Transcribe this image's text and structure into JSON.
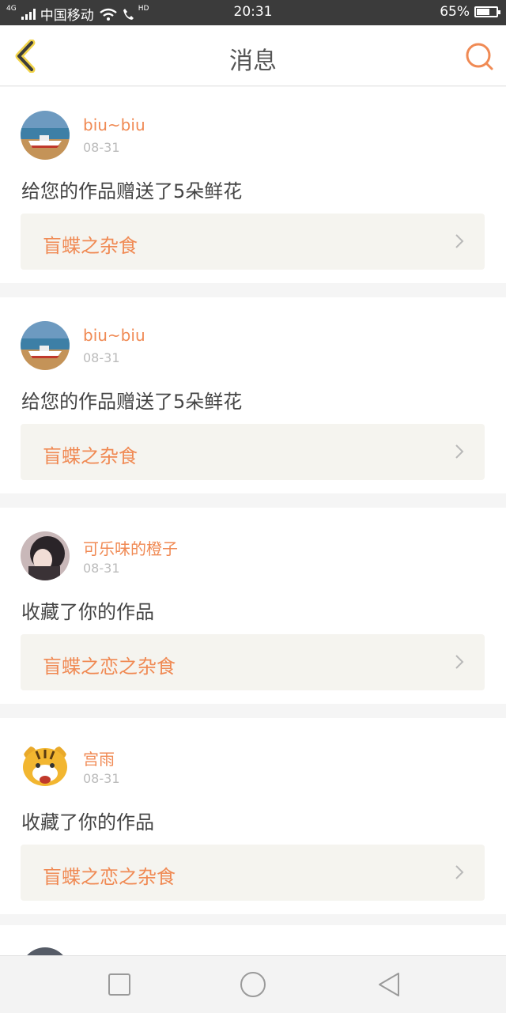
{
  "status_bar": {
    "network": "4G",
    "carrier": "中国移动",
    "hd": "HD",
    "time": "20:31",
    "battery": "65%",
    "battery_level": 0.65
  },
  "header": {
    "title": "消息",
    "back_icon": "chevron-left-icon",
    "search_icon": "search-icon"
  },
  "messages": [
    {
      "user": "biu~biu",
      "date": "08-31",
      "text": "给您的作品赠送了5朵鲜花",
      "work": "盲蝶之杂食",
      "avatar": "boat-avatar"
    },
    {
      "user": "biu~biu",
      "date": "08-31",
      "text": "给您的作品赠送了5朵鲜花",
      "work": "盲蝶之杂食",
      "avatar": "boat-avatar"
    },
    {
      "user": "可乐味的橙子",
      "date": "08-31",
      "text": "收藏了你的作品",
      "work": "盲蝶之恋之杂食",
      "avatar": "girl-avatar"
    },
    {
      "user": "宫雨",
      "date": "08-31",
      "text": "收藏了你的作品",
      "work": "盲蝶之恋之杂食",
      "avatar": "tiger-avatar"
    }
  ],
  "partial_message": {
    "user": ""
  },
  "nav_bar": {
    "recents_icon": "square-icon",
    "home_icon": "circle-icon",
    "back_icon": "triangle-back-icon"
  },
  "colors": {
    "accent": "#f08a54",
    "status_bar": "#3b3b3b",
    "link_bg": "#f5f4ef"
  }
}
